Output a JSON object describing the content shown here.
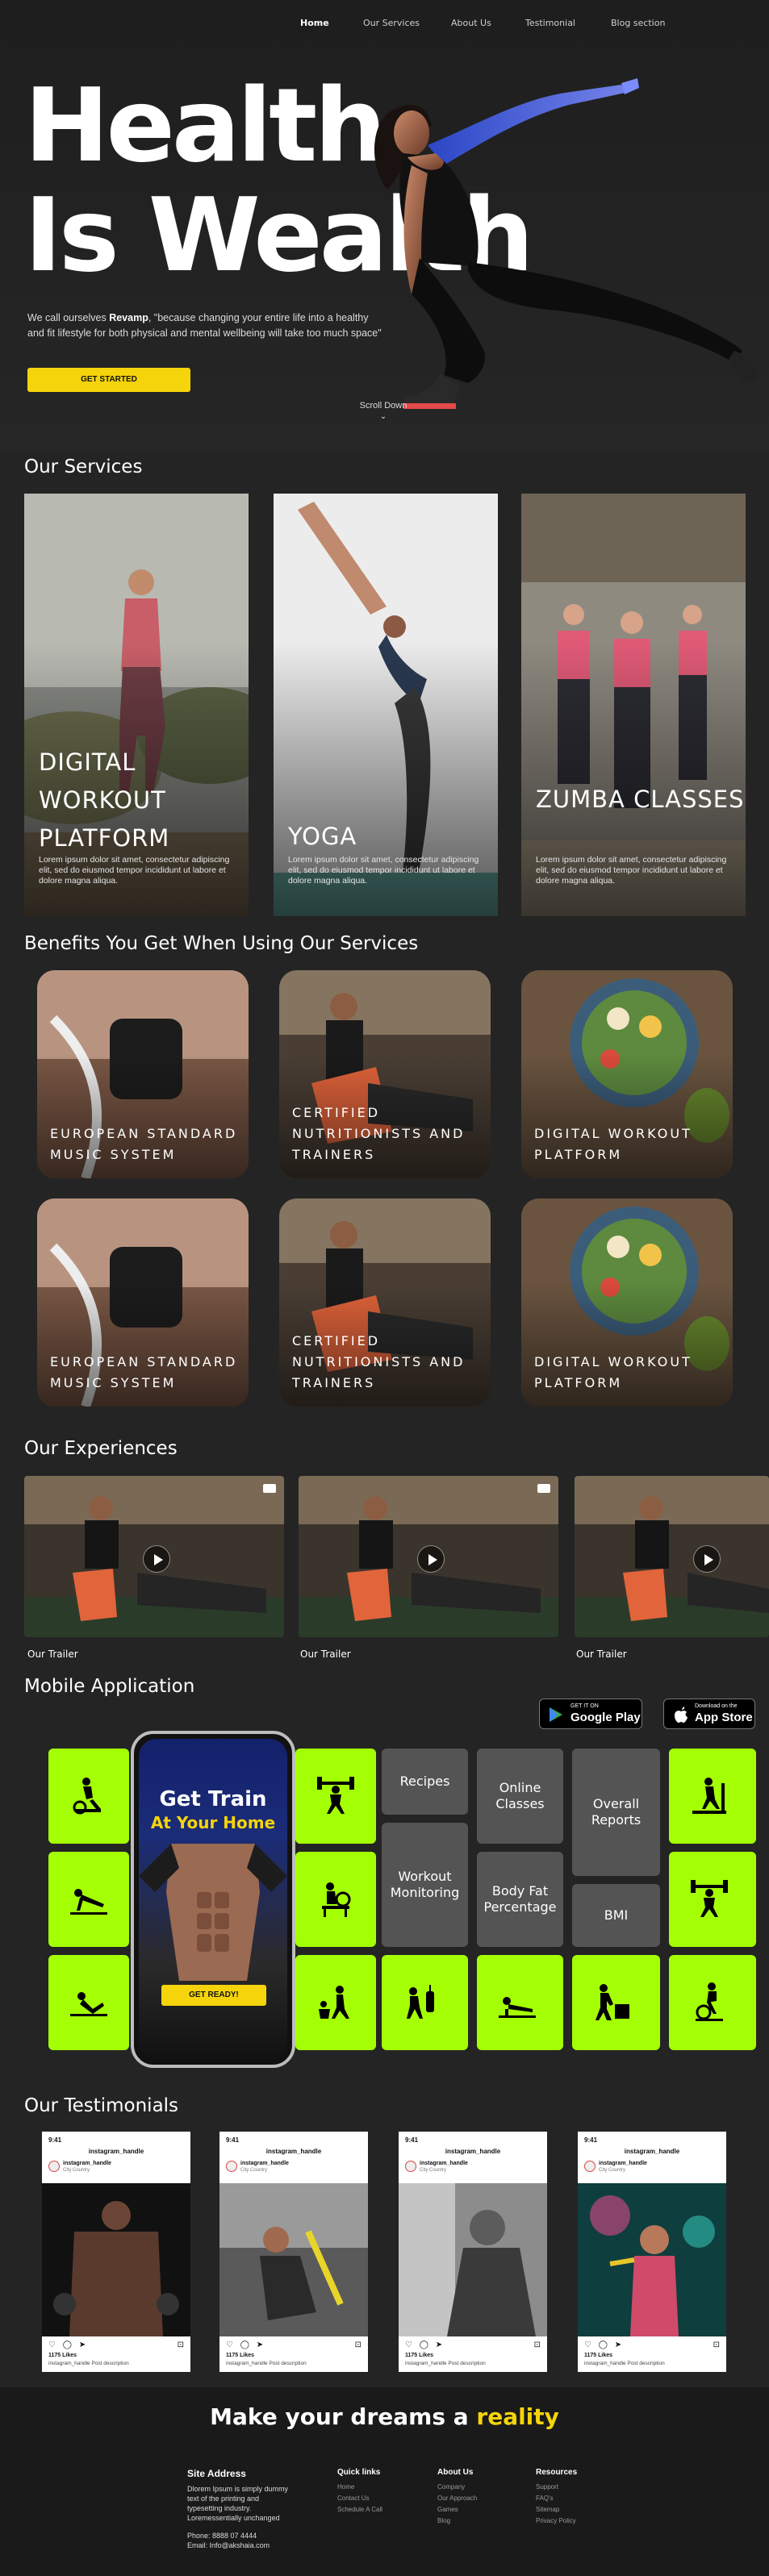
{
  "nav": {
    "items": [
      "Home",
      "Our Services",
      "About Us",
      "Testimonial",
      "Blog section"
    ]
  },
  "hero": {
    "title_line1": "Health",
    "title_line2": "Is Wealth",
    "desc_pre": "We call ourselves ",
    "desc_brand": "Revamp",
    "desc_post": ", \"because changing your entire life into a healthy and fit lifestyle for both physical and mental wellbeing will take too much space\"",
    "cta": "GET STARTED",
    "scroll": "Scroll Down"
  },
  "services": {
    "title": "Our Services",
    "cards": [
      {
        "title": "DIGITAL WORKOUT PLATFORM",
        "desc": "Lorem ipsum dolor sit amet, consectetur adipiscing elit, sed do eiusmod tempor incididunt ut labore et dolore magna aliqua."
      },
      {
        "title": "YOGA",
        "desc": "Lorem ipsum dolor sit amet, consectetur adipiscing elit, sed do eiusmod tempor incididunt ut labore et dolore magna aliqua."
      },
      {
        "title": "ZUMBA CLASSES",
        "desc": "Lorem ipsum dolor sit amet, consectetur adipiscing elit, sed do eiusmod tempor incididunt ut labore et dolore magna aliqua."
      }
    ]
  },
  "benefits": {
    "title": "Benefits You Get When Using Our Services",
    "items": [
      "EUROPEAN STANDARD MUSIC SYSTEM",
      "CERTIFIED NUTRITIONISTS AND TRAINERS",
      "DIGITAL WORKOUT PLATFORM",
      "EUROPEAN STANDARD MUSIC SYSTEM",
      "CERTIFIED NUTRITIONISTS AND TRAINERS",
      "DIGITAL WORKOUT PLATFORM"
    ]
  },
  "experiences": {
    "title": "Our Experiences",
    "items": [
      "Our Trailer",
      "Our Trailer",
      "Our Trailer"
    ]
  },
  "mobile": {
    "title": "Mobile Application",
    "google": {
      "small": "GET IT ON",
      "big": "Google Play"
    },
    "apple": {
      "small": "Download on the",
      "big": "App Store"
    },
    "phone": {
      "line1": "Get Train",
      "line2": "At Your Home",
      "cta": "GET READY!"
    },
    "tiles": {
      "recipes": "Recipes",
      "online": "Online Classes",
      "reports": "Overall Reports",
      "workout": "Workout Monitoring",
      "bodyfat": "Body Fat Percentage",
      "bmi": "BMI"
    },
    "accent": "#a4ff05"
  },
  "testimonials": {
    "title": "Our Testimonials",
    "posts": [
      {
        "time": "9:41",
        "handle": "instagram_handle",
        "user": "instagram_handle",
        "city": "City Country",
        "likes": "1175 Likes",
        "caption": "instagram_handle Post description"
      },
      {
        "time": "9:41",
        "handle": "instagram_handle",
        "user": "instagram_handle",
        "city": "City Country",
        "likes": "1175 Likes",
        "caption": "instagram_handle Post description"
      },
      {
        "time": "9:41",
        "handle": "instagram_handle",
        "user": "instagram_handle",
        "city": "City Country",
        "likes": "1175 Likes",
        "caption": "instagram_handle Post description"
      },
      {
        "time": "9:41",
        "handle": "instagram_handle",
        "user": "instagram_handle",
        "city": "City Country",
        "likes": "1175 Likes",
        "caption": "instagram_handle Post description"
      }
    ]
  },
  "footer": {
    "headline_pre": "Make your dreams a ",
    "headline_accent": "reality",
    "site": {
      "title": "Site Address",
      "text": "Dlorem Ipsum is simply dummy text of the printing and typesetting industry. Loremessentially unchanged",
      "phone": "Phone: 8888 07 4444",
      "email": "Email: Info@akshaia.com"
    },
    "quick": {
      "title": "Quick links",
      "items": [
        "Home",
        "Contact Us",
        "Schedule A Call"
      ]
    },
    "about": {
      "title": "About Us",
      "items": [
        "Company",
        "Our Approach",
        "Games",
        "Blog"
      ]
    },
    "resources": {
      "title": "Resources",
      "items": [
        "Support",
        "FAQ's",
        "Sitemap",
        "Privacy Policy"
      ]
    }
  }
}
